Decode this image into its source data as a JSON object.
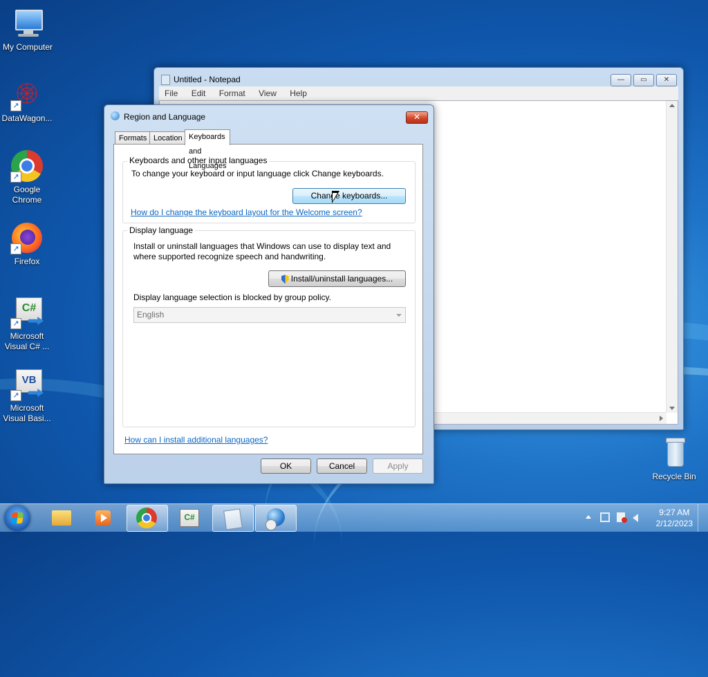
{
  "desktop": {
    "icons": [
      {
        "label": "My Computer"
      },
      {
        "label": "DataWagon..."
      },
      {
        "label": "Google Chrome"
      },
      {
        "label": "Firefox"
      },
      {
        "label": "Microsoft Visual C# ..."
      },
      {
        "label": "Microsoft Visual Basi..."
      },
      {
        "label": "Recycle Bin"
      }
    ]
  },
  "notepad": {
    "title": "Untitled - Notepad",
    "menu": [
      "File",
      "Edit",
      "Format",
      "View",
      "Help"
    ],
    "buttons": {
      "minimize": "—",
      "maximize": "▭",
      "close": "✕"
    }
  },
  "dialog": {
    "title": "Region and Language",
    "close": "✕",
    "tabs": [
      "Formats",
      "Location",
      "Keyboards and Languages"
    ],
    "keyboards": {
      "group_label": "Keyboards and other input languages",
      "description": "To change your keyboard or input language click Change keyboards.",
      "change_button": "Change keyboards...",
      "welcome_link": "How do I change the keyboard layout for the Welcome screen?"
    },
    "display": {
      "group_label": "Display language",
      "description_1": "Install or uninstall languages that Windows can use to display text and",
      "description_2": "where supported recognize speech and handwriting.",
      "install_button": "Install/uninstall languages...",
      "blocked_text": "Display language selection is blocked by group policy.",
      "selected_language": "English"
    },
    "additional_link": "How can I install additional languages?",
    "ok": "OK",
    "cancel": "Cancel",
    "apply": "Apply"
  },
  "taskbar": {
    "time": "9:27 AM",
    "date": "2/12/2023",
    "items": [
      "file-explorer-icon",
      "media-player-icon",
      "chrome-icon",
      "visual-csharp-icon",
      "notepad-icon",
      "region-language-icon"
    ]
  }
}
